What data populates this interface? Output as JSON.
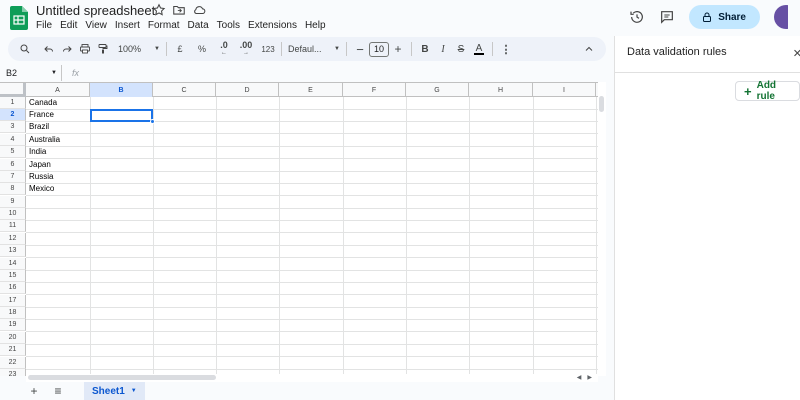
{
  "app": {
    "title": "Untitled spreadsheet",
    "menu": [
      "File",
      "Edit",
      "View",
      "Insert",
      "Format",
      "Data",
      "Tools",
      "Extensions",
      "Help"
    ],
    "share_label": "Share"
  },
  "toolbar": {
    "zoom": "100%",
    "currency": "£",
    "percent": "%",
    "decrease_decimal": ".0",
    "increase_decimal": ".00",
    "number_format": "123",
    "font": "Defaul...",
    "font_size": "10",
    "bold": "B",
    "italic": "I",
    "strikethrough": "S",
    "text_color": "A",
    "more": "⋮"
  },
  "formula_bar": {
    "cell_ref": "B2",
    "fx": "fx",
    "value": ""
  },
  "grid": {
    "columns": [
      "A",
      "B",
      "C",
      "D",
      "E",
      "F",
      "G",
      "H",
      "I"
    ],
    "rows": [
      "1",
      "2",
      "3",
      "4",
      "5",
      "6",
      "7",
      "8",
      "9",
      "10",
      "11",
      "12",
      "13",
      "14",
      "15",
      "16",
      "17",
      "18",
      "19",
      "20",
      "21",
      "22",
      "23"
    ],
    "selected_column": "B",
    "selected_row": "2",
    "column_a_values": [
      "Canada",
      "France",
      "Brazil",
      "Australia",
      "India",
      "Japan",
      "Russia",
      "Mexico"
    ]
  },
  "sheets": {
    "tabs": [
      "Sheet1"
    ],
    "active": "Sheet1"
  },
  "panel": {
    "title": "Data validation rules",
    "add_rule_label": "Add rule"
  },
  "colors": {
    "accent": "#1a73e8",
    "share_bg": "#c2e7ff",
    "toolbar_bg": "#eef2f9",
    "sheet_tab_bg": "#e1e9f7",
    "add_rule_text": "#137333"
  }
}
